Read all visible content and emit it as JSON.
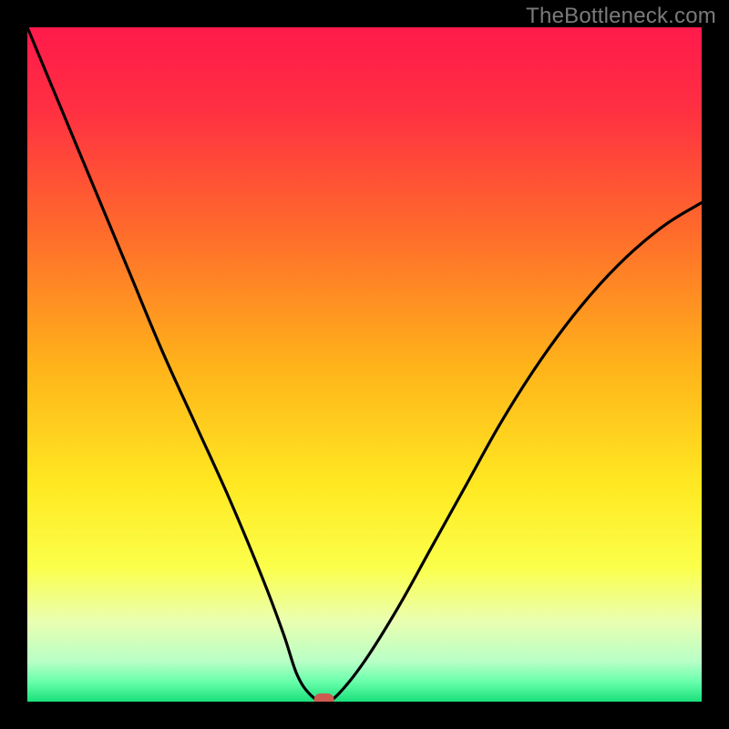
{
  "watermark": "TheBottleneck.com",
  "chart_data": {
    "type": "line",
    "title": "",
    "xlabel": "",
    "ylabel": "",
    "xlim": [
      0,
      100
    ],
    "ylim": [
      0,
      100
    ],
    "gradient_stops": [
      {
        "offset": 0.0,
        "color": "#ff1a4b"
      },
      {
        "offset": 0.12,
        "color": "#ff2f42"
      },
      {
        "offset": 0.3,
        "color": "#ff6a2c"
      },
      {
        "offset": 0.5,
        "color": "#ffb21a"
      },
      {
        "offset": 0.68,
        "color": "#ffe922"
      },
      {
        "offset": 0.8,
        "color": "#fbff4a"
      },
      {
        "offset": 0.88,
        "color": "#eaffb0"
      },
      {
        "offset": 0.94,
        "color": "#b8ffc6"
      },
      {
        "offset": 0.97,
        "color": "#6affac"
      },
      {
        "offset": 1.0,
        "color": "#19e07a"
      }
    ],
    "series": [
      {
        "name": "bottleneck-curve",
        "x": [
          0,
          5,
          10,
          15,
          20,
          25,
          30,
          35,
          38,
          40,
          42,
          44,
          46,
          50,
          55,
          60,
          65,
          70,
          75,
          80,
          85,
          90,
          95,
          100
        ],
        "y": [
          100,
          88,
          76,
          64,
          52,
          41,
          30,
          18,
          10,
          4,
          1,
          0,
          1,
          6,
          14,
          23,
          32,
          41,
          49,
          56,
          62,
          67,
          71,
          74
        ]
      }
    ],
    "marker": {
      "x": 44,
      "y": 0,
      "color": "#cf5a4f"
    }
  }
}
